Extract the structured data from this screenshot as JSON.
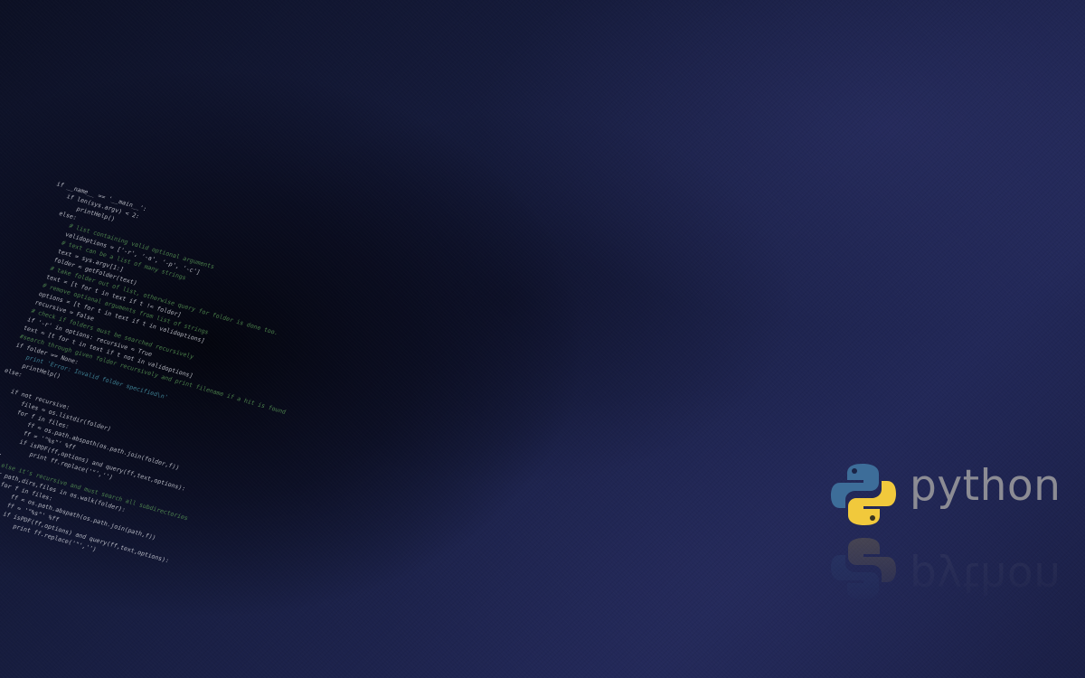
{
  "wallpaper": {
    "colors": {
      "background_dark": "#0c1024",
      "background_mid": "#1f2551",
      "code_text": "#d2d4dc",
      "code_comment": "#5fa35a",
      "code_string": "#4fa4b8",
      "python_blue": "#3d6d99",
      "python_yellow": "#f1c93c",
      "wordmark": "#8c8c94"
    },
    "logo": {
      "wordmark": "python",
      "reflection_wordmark": "python",
      "icon": "python-snakes-icon"
    },
    "code": [
      {
        "text": "if __name__ == '__main__':",
        "kind": "code"
      },
      {
        "text": "    if len(sys.argv) < 2:",
        "kind": "code"
      },
      {
        "text": "        printHelp()",
        "kind": "code"
      },
      {
        "text": "    else:",
        "kind": "code"
      },
      {
        "text": "        # list containing valid optional arguments",
        "kind": "comment"
      },
      {
        "text": "        validoptions = ['-r', '-a', '-p', '-c']",
        "kind": "code"
      },
      {
        "text": "        # text can be a list of many strings",
        "kind": "comment"
      },
      {
        "text": "        text = sys.argv[1:]",
        "kind": "code"
      },
      {
        "text": "        folder = getFolder(text)",
        "kind": "code"
      },
      {
        "text": "        # take folder out of list, otherwise query for folder is done too.",
        "kind": "comment"
      },
      {
        "text": "        text = [t for t in text if t != folder]",
        "kind": "code"
      },
      {
        "text": "        # remove optional arguments from list of strings",
        "kind": "comment"
      },
      {
        "text": "        options = [t for t in text if t in validoptions]",
        "kind": "code"
      },
      {
        "text": "        recursive = False",
        "kind": "code"
      },
      {
        "text": "        # check if folders must be searched recursively",
        "kind": "comment"
      },
      {
        "text": "        if '-r' in options: recursive = True",
        "kind": "code"
      },
      {
        "text": "        text = [t for t in text if t not in validoptions]",
        "kind": "code"
      },
      {
        "text": "        #search through given folder recursively and print filename if a hit is found",
        "kind": "comment"
      },
      {
        "text": "        if folder == None:",
        "kind": "code"
      },
      {
        "text": "            print 'Error: Invalid folder specified\\n'",
        "kind": "string"
      },
      {
        "text": "            printHelp()",
        "kind": "code"
      },
      {
        "text": "        else:",
        "kind": "code"
      },
      {
        "text": "",
        "kind": "code"
      },
      {
        "text": "            if not recursive:",
        "kind": "code"
      },
      {
        "text": "                files = os.listdir(folder)",
        "kind": "code"
      },
      {
        "text": "                for f in files:",
        "kind": "code"
      },
      {
        "text": "                    ff = os.path.abspath(os.path.join(folder,f))",
        "kind": "code"
      },
      {
        "text": "                    ff = '\"%s\"' %ff",
        "kind": "code"
      },
      {
        "text": "                    if isPDF(ff,options) and query(ff,text,options):",
        "kind": "code"
      },
      {
        "text": "                        print ff.replace('\"','')",
        "kind": "code"
      },
      {
        "text": "            else:",
        "kind": "code"
      },
      {
        "text": "                # else it's recursive and must search all subdirectories",
        "kind": "comment"
      },
      {
        "text": "                for path,dirs,files in os.walk(folder):",
        "kind": "code"
      },
      {
        "text": "                    for f in files:",
        "kind": "code"
      },
      {
        "text": "                        ff = os.path.abspath(os.path.join(path,f))",
        "kind": "code"
      },
      {
        "text": "                        ff = '\"%s\"' %ff",
        "kind": "code"
      },
      {
        "text": "                        if isPDF(ff,options) and query(ff,text,options):",
        "kind": "code"
      },
      {
        "text": "                            print ff.replace('\"','')",
        "kind": "code"
      }
    ]
  }
}
